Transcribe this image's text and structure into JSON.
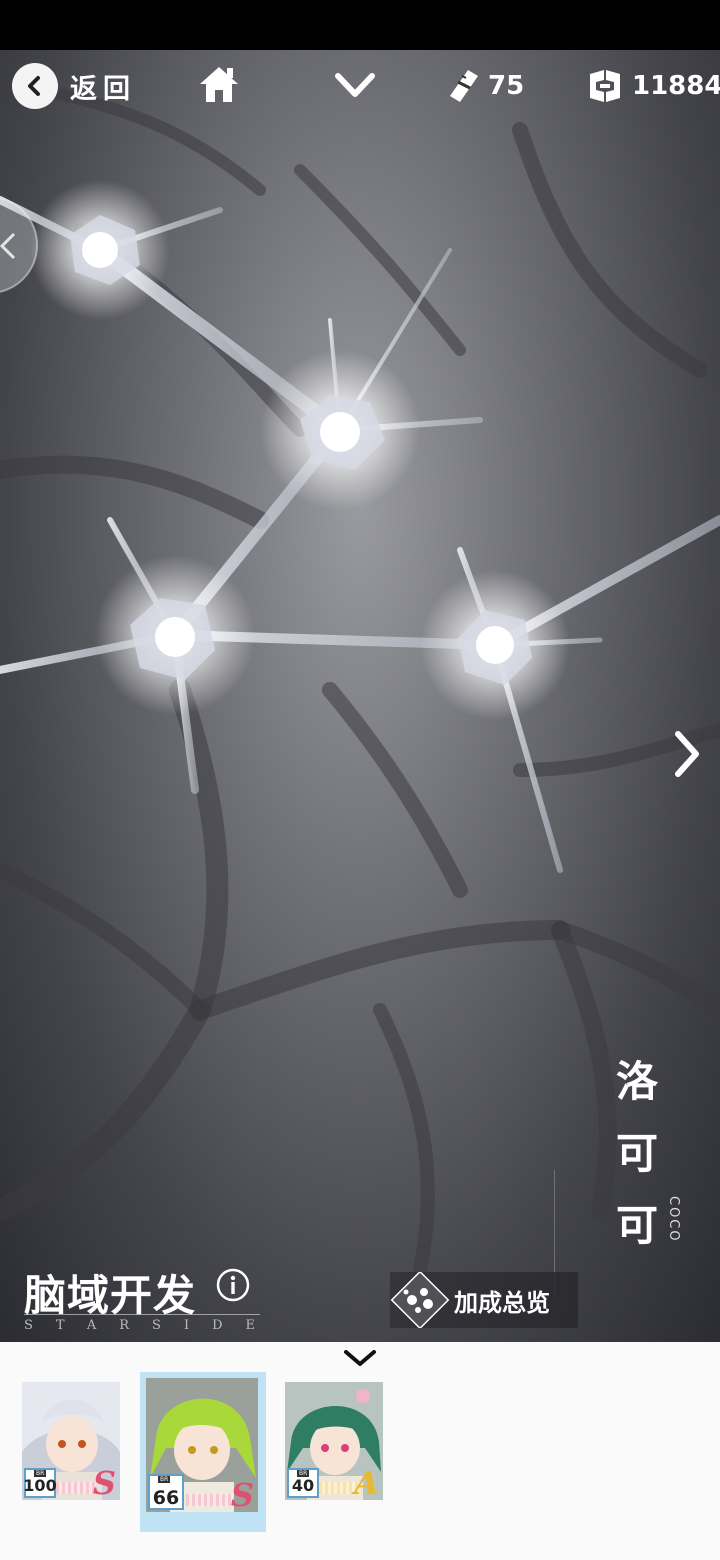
{
  "topbar": {
    "back_label": "返回",
    "resources": [
      {
        "icon": "stamina-icon",
        "value": "75"
      },
      {
        "icon": "currency-icon",
        "value": "11884"
      }
    ]
  },
  "character": {
    "name": "洛可可",
    "romanized": "COCO"
  },
  "feature": {
    "title": "脑域开发",
    "subtitle": "STARSIDE"
  },
  "bonus_button": {
    "label": "加成总览"
  },
  "roster": [
    {
      "level": "100",
      "rank": "S",
      "selected": false,
      "hair_color": "#dfe2ea"
    },
    {
      "level": "66",
      "rank": "S",
      "selected": true,
      "hair_color": "#a9d83a"
    },
    {
      "level": "40",
      "rank": "A",
      "selected": false,
      "hair_color": "#2f7d62"
    }
  ],
  "level_tag": "BR",
  "colors": {
    "selected_card_bg": "#bfe3f4",
    "rank_s": "#e05070",
    "rank_a": "#e8b830"
  }
}
